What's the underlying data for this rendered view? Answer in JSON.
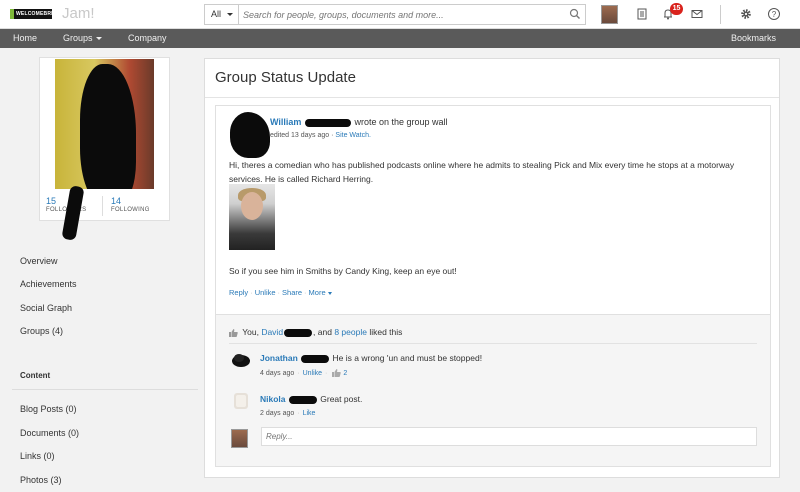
{
  "topbar": {
    "logo_text": "WELCOMEBREAK",
    "app_name": "Jam!",
    "search_scope": "All",
    "search_placeholder": "Search for people, groups, documents and more...",
    "notification_count": "15",
    "icons": [
      "avatar",
      "tasks-icon",
      "bell-icon",
      "mail-icon",
      "gear-icon",
      "help-icon"
    ]
  },
  "nav": {
    "home": "Home",
    "groups": "Groups",
    "company": "Company",
    "bookmarks": "Bookmarks"
  },
  "profile": {
    "followers_count": "15",
    "followers_label": "FOLLOWERS",
    "following_count": "14",
    "following_label": "FOLLOWING"
  },
  "left_menu": {
    "items": [
      "Overview",
      "Achievements",
      "Social Graph",
      "Groups (4)"
    ],
    "content_heading": "Content",
    "content_items": [
      "Blog Posts (0)",
      "Documents (0)",
      "Links (0)",
      "Photos (3)"
    ]
  },
  "main": {
    "title": "Group Status Update",
    "post": {
      "author": "William",
      "action": "wrote on the group wall",
      "meta_time": "edited 13 days ago",
      "meta_sep": "·",
      "meta_link": "Site Watch.",
      "body": "Hi, theres a comedian who has published podcasts online where he admits to stealing Pick and Mix every time he stops at a motorway services. He is called Richard Herring.",
      "footer": "So if you see him in Smiths by Candy King, keep an eye out!",
      "actions": {
        "reply": "Reply",
        "unlike": "Unlike",
        "share": "Share",
        "more": "More",
        "sep": "·"
      }
    },
    "likes": {
      "prefix": "You,",
      "person": "David",
      "middle": ", and",
      "count_link": "8 people",
      "suffix": "liked this"
    },
    "comments": [
      {
        "author": "Jonathan",
        "text": "He is a wrong 'un and must be stopped!",
        "time": "4 days ago",
        "action": "Unlike",
        "likes": "2"
      },
      {
        "author": "Nikola",
        "text": "Great post.",
        "time": "2 days ago",
        "action": "Like"
      }
    ],
    "reply_placeholder": "Reply..."
  },
  "colors": {
    "link": "#2a7ab8",
    "nav_bg": "#5a5a5a",
    "badge": "#d9221c",
    "logo_accent": "#7fb93a"
  }
}
